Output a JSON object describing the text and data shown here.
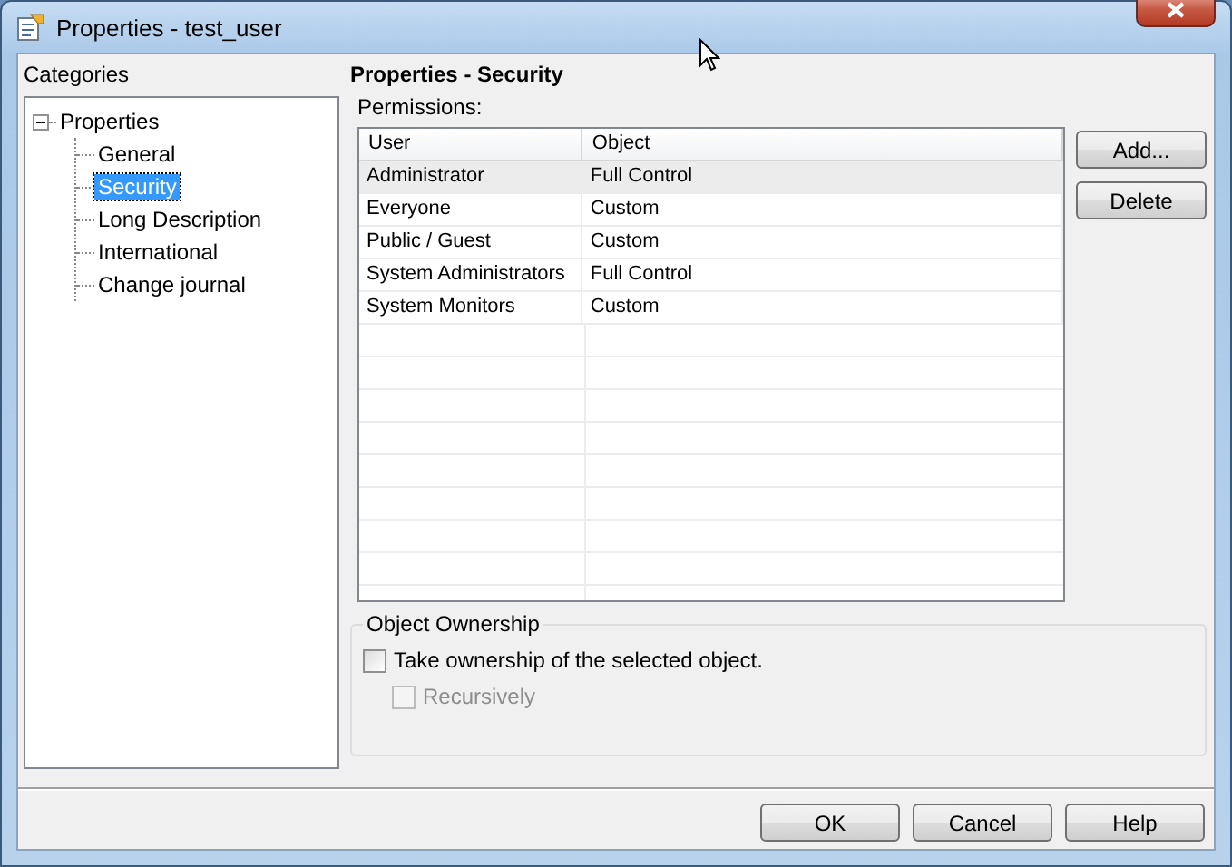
{
  "window": {
    "title": "Properties - test_user"
  },
  "categories": {
    "label": "Categories",
    "tree": [
      {
        "label": "Properties",
        "expanded": true,
        "selected": false,
        "children": [
          {
            "label": "General",
            "selected": false
          },
          {
            "label": "Security",
            "selected": true
          },
          {
            "label": "Long Description",
            "selected": false
          },
          {
            "label": "International",
            "selected": false
          },
          {
            "label": "Change journal",
            "selected": false
          }
        ]
      }
    ]
  },
  "page_title": "Properties - Security",
  "permissions": {
    "label": "Permissions:",
    "columns": [
      "User",
      "Object"
    ],
    "rows": [
      {
        "cells": [
          "Administrator",
          "Full Control"
        ],
        "selected": true
      },
      {
        "cells": [
          "Everyone",
          "Custom"
        ],
        "selected": false
      },
      {
        "cells": [
          "Public / Guest",
          "Custom"
        ],
        "selected": false
      },
      {
        "cells": [
          "System Administrators",
          "Full Control"
        ],
        "selected": false
      },
      {
        "cells": [
          "System Monitors",
          "Custom"
        ],
        "selected": false
      }
    ]
  },
  "side_buttons": [
    "Add...",
    "Delete"
  ],
  "ownership": {
    "title": "Object Ownership",
    "options": [
      {
        "label": "Take ownership of the selected object.",
        "checked": false,
        "disabled": false
      },
      {
        "label": "Recursively",
        "checked": false,
        "disabled": true
      }
    ]
  },
  "buttons": [
    "OK",
    "Cancel",
    "Help"
  ]
}
